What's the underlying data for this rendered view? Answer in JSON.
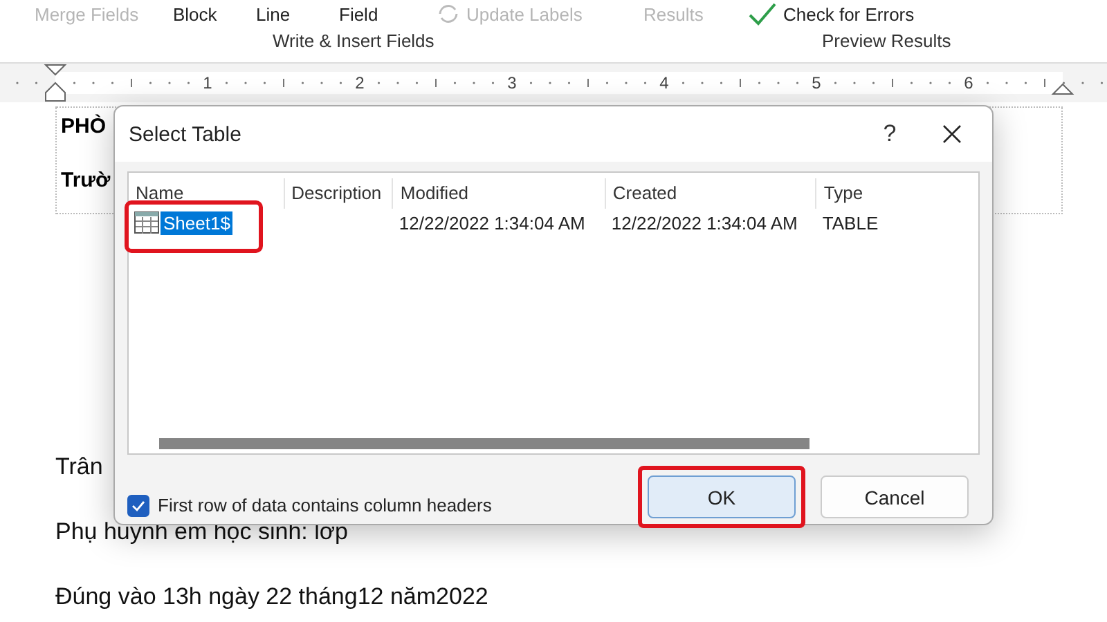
{
  "ribbon": {
    "buttons": [
      {
        "label": "Merge Fields",
        "disabled": true
      },
      {
        "label": "Block",
        "disabled": false
      },
      {
        "label": "Line",
        "disabled": false
      },
      {
        "label": "Field",
        "disabled": false
      },
      {
        "label": "Update Labels",
        "disabled": true,
        "kind": "refresh"
      },
      {
        "label": "Results",
        "disabled": true
      },
      {
        "label": "Check for Errors",
        "disabled": false,
        "kind": "check"
      }
    ],
    "groups": [
      {
        "label": "Write & Insert Fields"
      },
      {
        "label": "Preview Results"
      }
    ]
  },
  "ruler": {
    "numbers": [
      "1",
      "2",
      "3",
      "4",
      "5",
      "6"
    ]
  },
  "document": {
    "box_lines": [
      "PHÒ",
      "Trườ"
    ],
    "lines": [
      "Trân",
      "Phụ huynh em học sinh:  lớp",
      "Đúng vào 13h ngày 22 tháng12 năm2022"
    ]
  },
  "dialog": {
    "title": "Select Table",
    "help": "?",
    "columns": [
      "Name",
      "Description",
      "Modified",
      "Created",
      "Type"
    ],
    "rows": [
      {
        "name": "Sheet1$",
        "description": "",
        "modified": "12/22/2022 1:34:04 AM",
        "created": "12/22/2022 1:34:04 AM",
        "type": "TABLE",
        "selected": true,
        "highlighted": true
      }
    ],
    "checkbox": {
      "label": "First row of data contains column headers",
      "checked": true
    },
    "buttons": [
      {
        "label": "OK",
        "default": true,
        "highlighted": true
      },
      {
        "label": "Cancel",
        "default": false,
        "highlighted": false
      }
    ]
  }
}
